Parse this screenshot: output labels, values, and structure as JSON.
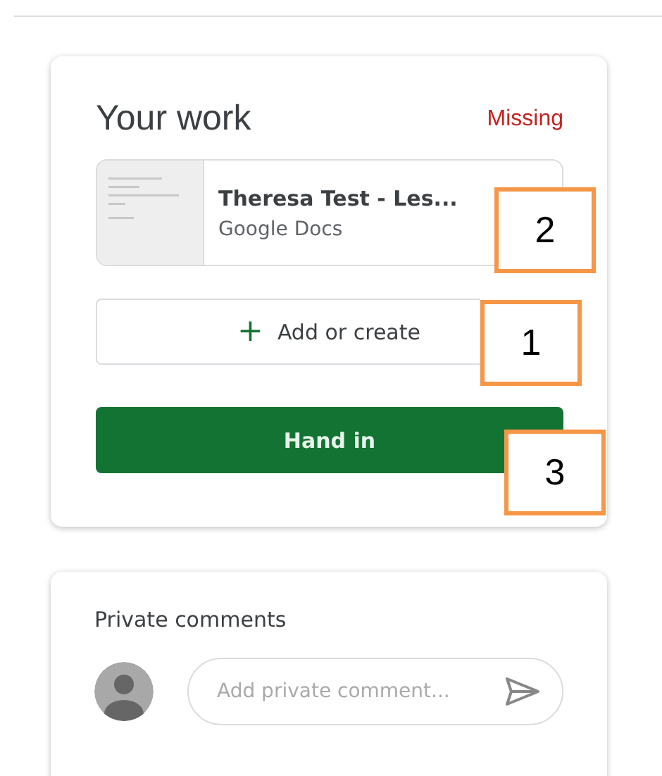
{
  "work_card": {
    "title": "Your work",
    "status": "Missing",
    "attachment": {
      "title": "Theresa Test - Les...",
      "subtitle": "Google Docs"
    },
    "add_button": {
      "icon": "+",
      "label": "Add or create"
    },
    "hand_in_button": {
      "label": "Hand in"
    }
  },
  "comments_card": {
    "title": "Private comments",
    "input": {
      "placeholder": "Add private comment..."
    }
  },
  "callouts": [
    {
      "label": "2"
    },
    {
      "label": "1"
    },
    {
      "label": "3"
    }
  ]
}
